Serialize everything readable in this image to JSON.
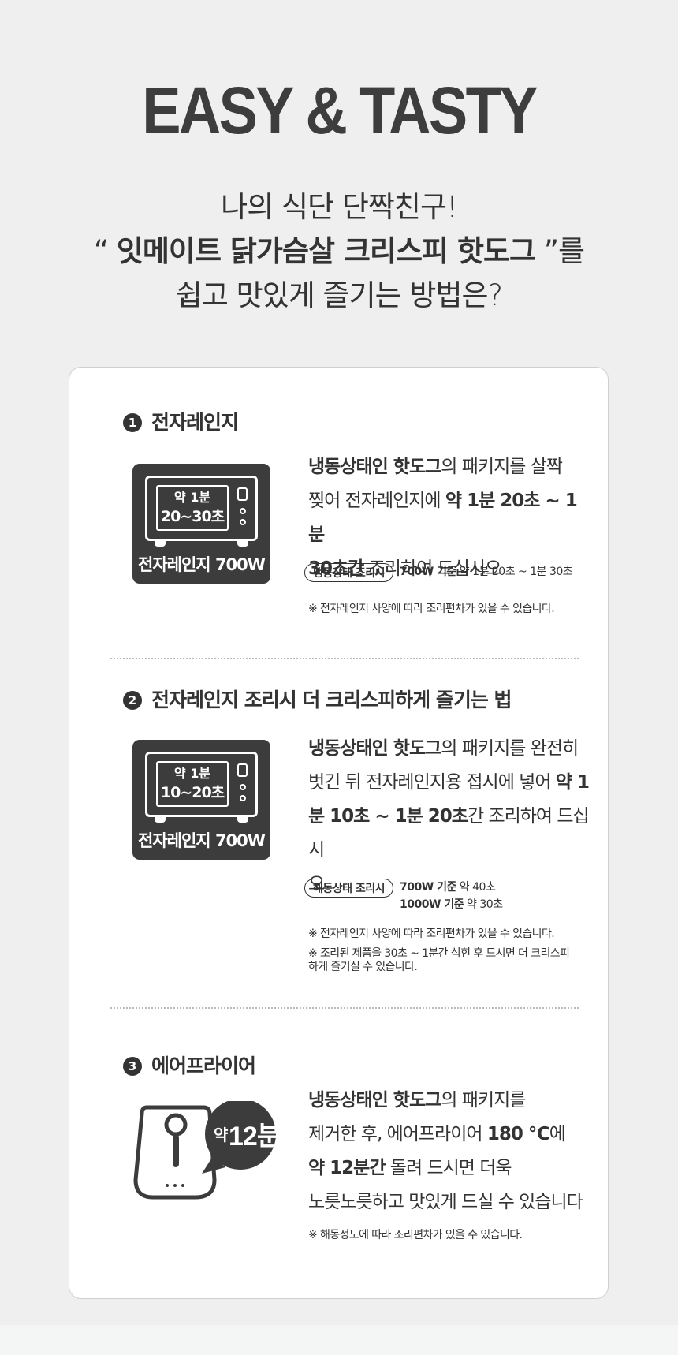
{
  "hero": {
    "title": "EASY & TASTY"
  },
  "intro": {
    "line1": "나의 식단 단짝친구!",
    "line2_open": "“ ",
    "line2_product": "잇메이트 닭가슴살 크리스피 핫도그",
    "line2_close": " ”를",
    "line3": "쉽고 맛있게 즐기는 방법은?"
  },
  "sections": [
    {
      "number": "1",
      "title": "전자레인지",
      "icon": {
        "time_top": "약 1분",
        "time_bottom": "20~30초",
        "label": "전자레인지 700W"
      },
      "desc": {
        "b1": "냉동상태인 핫도그",
        "t1": "의 패키지를 살짝",
        "t2": "찢어 전자레인지에 ",
        "b2": "약 1분 20초 ~ 1분",
        "b3": "30초간",
        "t3": " 조리하여 드십시오"
      },
      "tag": {
        "pill": "냉동상태 조리시",
        "bold": "700W 기준",
        "text": " 약 1분 20초 ~ 1분 30초"
      },
      "notes": [
        "※ 전자레인지 사양에 따라 조리편차가 있을 수 있습니다."
      ]
    },
    {
      "number": "2",
      "title": "전자레인지 조리시 더 크리스피하게 즐기는 법",
      "icon": {
        "time_top": "약 1분",
        "time_bottom": "10~20초",
        "label": "전자레인지 700W"
      },
      "desc": {
        "b1": "냉동상태인 핫도그",
        "t1": "의 패키지를 완전히",
        "t2": "벗긴 뒤 전자레인지용 접시에 넣어 ",
        "b2": "약 1",
        "b3": "분 10초 ~ 1분 20초",
        "t3": "간 조리하여 드십시",
        "t4": "오"
      },
      "tag": {
        "pill": "해동상태 조리시",
        "bold1": "700W 기준",
        "text1": " 약 40초",
        "bold2": "1000W 기준",
        "text2": " 약 30초"
      },
      "notes": [
        "※ 전자레인지 사양에 따라 조리편차가 있을 수 있습니다.",
        "※ 조리된 제품을 30초 ~ 1분간 식힌 후 드시면 더 크리스피",
        "하게 즐기실 수 있습니다."
      ]
    },
    {
      "number": "3",
      "title": "에어프라이어",
      "icon": {
        "badge_small": "약",
        "badge_big": "12분"
      },
      "desc": {
        "b1": "냉동상태인 핫도그",
        "t1": "의 패키지를",
        "t2": "제거한 후, 에어프라이어 ",
        "b2": "180 ℃",
        "t2b": "에",
        "b3": "약 12분간",
        "t3": " 돌려 드시면 더욱",
        "t4": "노릇노릇하고 맛있게 드실 수 있습니다"
      },
      "notes": [
        "※ 해동정도에 따라 조리편차가 있을 수 있습니다."
      ]
    }
  ]
}
